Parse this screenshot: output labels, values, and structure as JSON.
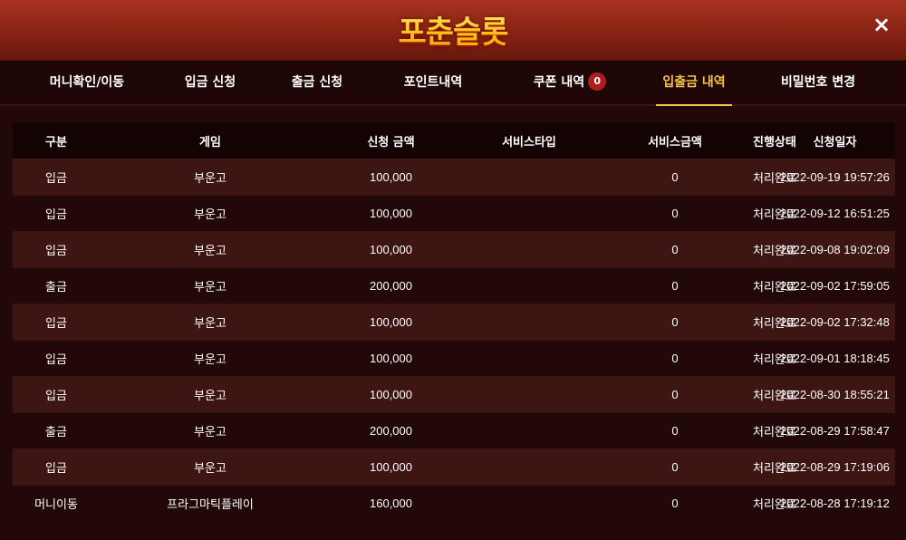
{
  "header": {
    "logo_text": "포춘슬롯",
    "close_label": "×"
  },
  "tabs": [
    {
      "label": "머니확인/이동"
    },
    {
      "label": "입금 신청"
    },
    {
      "label": "출금 신청"
    },
    {
      "label": "포인트내역"
    },
    {
      "label": "쿠폰 내역",
      "badge": "0"
    },
    {
      "label": "입출금 내역",
      "active": true
    },
    {
      "label": "비밀번호 변경"
    }
  ],
  "table": {
    "columns": [
      "구분",
      "게임",
      "신청 금액",
      "서비스타입",
      "서비스금액",
      "진행상태",
      "신청일자"
    ],
    "rows": [
      {
        "type": "입금",
        "game": "부운고",
        "amount": "100,000",
        "service_type": "",
        "service_amount": "0",
        "status": "처리완료",
        "date": "2022-09-19 19:57:26"
      },
      {
        "type": "입금",
        "game": "부운고",
        "amount": "100,000",
        "service_type": "",
        "service_amount": "0",
        "status": "처리완료",
        "date": "2022-09-12 16:51:25"
      },
      {
        "type": "입금",
        "game": "부운고",
        "amount": "100,000",
        "service_type": "",
        "service_amount": "0",
        "status": "처리완료",
        "date": "2022-09-08 19:02:09"
      },
      {
        "type": "출금",
        "game": "부운고",
        "amount": "200,000",
        "service_type": "",
        "service_amount": "0",
        "status": "처리완료",
        "date": "2022-09-02 17:59:05"
      },
      {
        "type": "입금",
        "game": "부운고",
        "amount": "100,000",
        "service_type": "",
        "service_amount": "0",
        "status": "처리완료",
        "date": "2022-09-02 17:32:48"
      },
      {
        "type": "입금",
        "game": "부운고",
        "amount": "100,000",
        "service_type": "",
        "service_amount": "0",
        "status": "처리완료",
        "date": "2022-09-01 18:18:45"
      },
      {
        "type": "입금",
        "game": "부운고",
        "amount": "100,000",
        "service_type": "",
        "service_amount": "0",
        "status": "처리완료",
        "date": "2022-08-30 18:55:21"
      },
      {
        "type": "출금",
        "game": "부운고",
        "amount": "200,000",
        "service_type": "",
        "service_amount": "0",
        "status": "처리완료",
        "date": "2022-08-29 17:58:47"
      },
      {
        "type": "입금",
        "game": "부운고",
        "amount": "100,000",
        "service_type": "",
        "service_amount": "0",
        "status": "처리완료",
        "date": "2022-08-29 17:19:06"
      },
      {
        "type": "머니이동",
        "game": "프라그마틱플레이",
        "amount": "160,000",
        "service_type": "",
        "service_amount": "0",
        "status": "처리완료",
        "date": "2022-08-28 17:19:12"
      }
    ]
  }
}
